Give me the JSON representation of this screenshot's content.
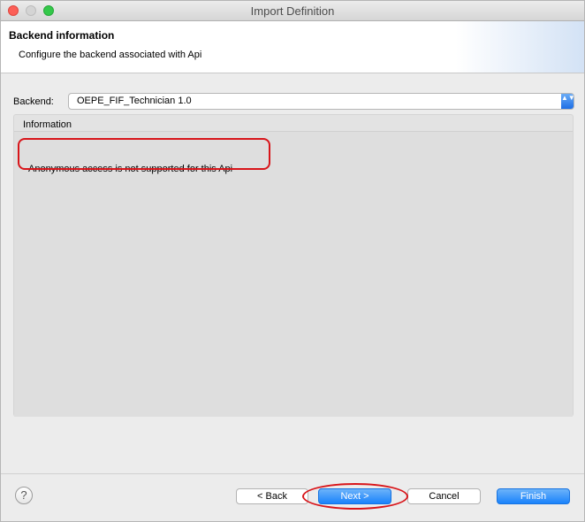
{
  "window": {
    "title": "Import Definition"
  },
  "header": {
    "title": "Backend information",
    "description": "Configure the backend associated with Api"
  },
  "backend": {
    "label": "Backend:",
    "value": "OEPE_FIF_Technician 1.0",
    "arrow_glyph": "▲▼"
  },
  "information": {
    "label": "Information",
    "message": "Anonymous access is not supported for this Api"
  },
  "footer": {
    "help_glyph": "?",
    "back_label": "< Back",
    "next_label": "Next >",
    "cancel_label": "Cancel",
    "finish_label": "Finish"
  },
  "colors": {
    "annotation": "#d8151a",
    "accent": "#1a82fb"
  },
  "icons": [
    "close-icon",
    "minimize-icon",
    "zoom-icon",
    "help-icon",
    "select-arrows-icon"
  ]
}
